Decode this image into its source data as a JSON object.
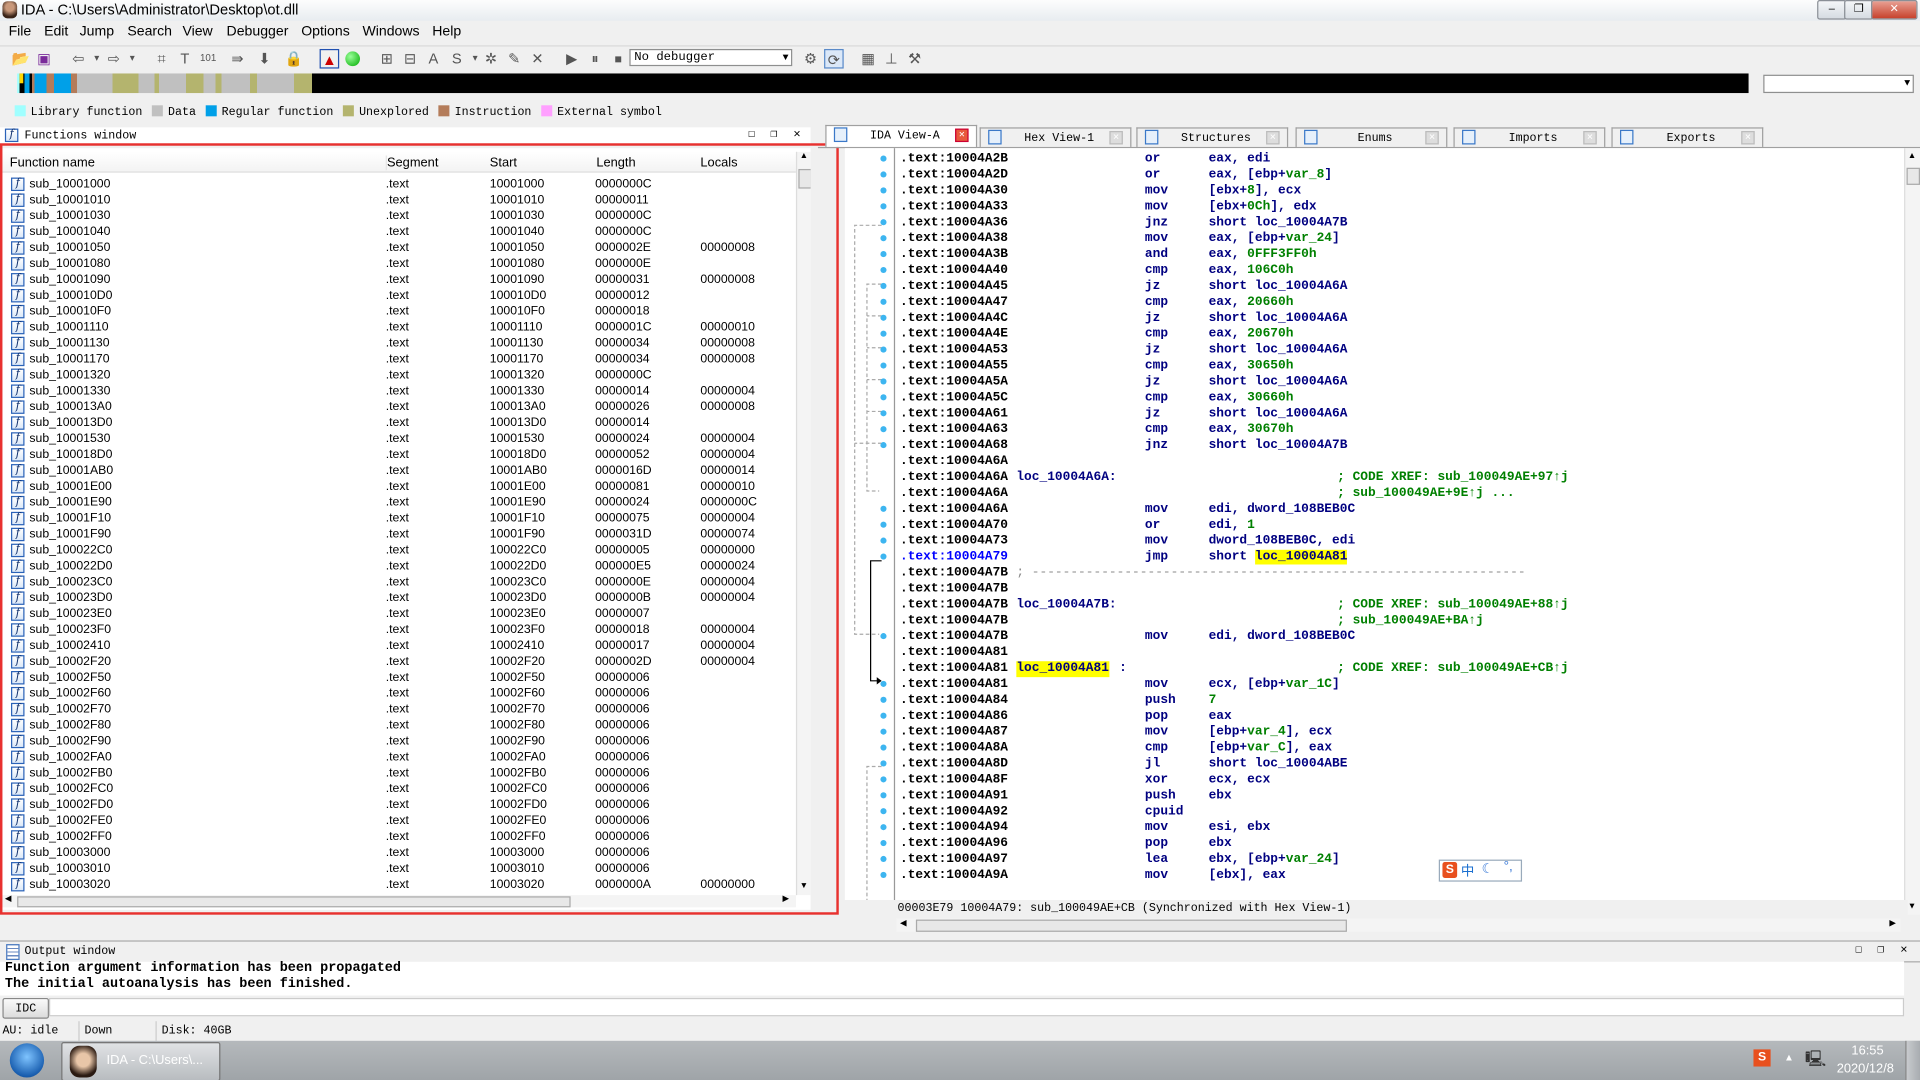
{
  "window": {
    "title": "IDA - C:\\Users\\Administrator\\Desktop\\ot.dll"
  },
  "menu": [
    "File",
    "Edit",
    "Jump",
    "Search",
    "View",
    "Debugger",
    "Options",
    "Windows",
    "Help"
  ],
  "toolbar": {
    "debugger_select": "No debugger"
  },
  "legend": [
    {
      "label": "Library function",
      "color": "#a0ffff"
    },
    {
      "label": "Data",
      "color": "#c0c0c0"
    },
    {
      "label": "Regular function",
      "color": "#00a0e8"
    },
    {
      "label": "Unexplored",
      "color": "#b4b46e"
    },
    {
      "label": "Instruction",
      "color": "#b47c5a"
    },
    {
      "label": "External symbol",
      "color": "#ffa0ff"
    }
  ],
  "functions_window": {
    "title": "Functions window",
    "columns": [
      "Function name",
      "Segment",
      "Start",
      "Length",
      "Locals"
    ],
    "rows": [
      [
        "sub_10001000",
        ".text",
        "10001000",
        "0000000C",
        ""
      ],
      [
        "sub_10001010",
        ".text",
        "10001010",
        "00000011",
        ""
      ],
      [
        "sub_10001030",
        ".text",
        "10001030",
        "0000000C",
        ""
      ],
      [
        "sub_10001040",
        ".text",
        "10001040",
        "0000000C",
        ""
      ],
      [
        "sub_10001050",
        ".text",
        "10001050",
        "0000002E",
        "00000008"
      ],
      [
        "sub_10001080",
        ".text",
        "10001080",
        "0000000E",
        ""
      ],
      [
        "sub_10001090",
        ".text",
        "10001090",
        "00000031",
        "00000008"
      ],
      [
        "sub_100010D0",
        ".text",
        "100010D0",
        "00000012",
        ""
      ],
      [
        "sub_100010F0",
        ".text",
        "100010F0",
        "00000018",
        ""
      ],
      [
        "sub_10001110",
        ".text",
        "10001110",
        "0000001C",
        "00000010"
      ],
      [
        "sub_10001130",
        ".text",
        "10001130",
        "00000034",
        "00000008"
      ],
      [
        "sub_10001170",
        ".text",
        "10001170",
        "00000034",
        "00000008"
      ],
      [
        "sub_10001320",
        ".text",
        "10001320",
        "0000000C",
        ""
      ],
      [
        "sub_10001330",
        ".text",
        "10001330",
        "00000014",
        "00000004"
      ],
      [
        "sub_100013A0",
        ".text",
        "100013A0",
        "00000026",
        "00000008"
      ],
      [
        "sub_100013D0",
        ".text",
        "100013D0",
        "00000014",
        ""
      ],
      [
        "sub_10001530",
        ".text",
        "10001530",
        "00000024",
        "00000004"
      ],
      [
        "sub_100018D0",
        ".text",
        "100018D0",
        "00000052",
        "00000004"
      ],
      [
        "sub_10001AB0",
        ".text",
        "10001AB0",
        "0000016D",
        "00000014"
      ],
      [
        "sub_10001E00",
        ".text",
        "10001E00",
        "00000081",
        "00000010"
      ],
      [
        "sub_10001E90",
        ".text",
        "10001E90",
        "00000024",
        "0000000C"
      ],
      [
        "sub_10001F10",
        ".text",
        "10001F10",
        "00000075",
        "00000004"
      ],
      [
        "sub_10001F90",
        ".text",
        "10001F90",
        "0000031D",
        "00000074"
      ],
      [
        "sub_100022C0",
        ".text",
        "100022C0",
        "00000005",
        "00000000"
      ],
      [
        "sub_100022D0",
        ".text",
        "100022D0",
        "000000E5",
        "00000024"
      ],
      [
        "sub_100023C0",
        ".text",
        "100023C0",
        "0000000E",
        "00000004"
      ],
      [
        "sub_100023D0",
        ".text",
        "100023D0",
        "0000000B",
        "00000004"
      ],
      [
        "sub_100023E0",
        ".text",
        "100023E0",
        "00000007",
        ""
      ],
      [
        "sub_100023F0",
        ".text",
        "100023F0",
        "00000018",
        "00000004"
      ],
      [
        "sub_10002410",
        ".text",
        "10002410",
        "00000017",
        "00000004"
      ],
      [
        "sub_10002F20",
        ".text",
        "10002F20",
        "0000002D",
        "00000004"
      ],
      [
        "sub_10002F50",
        ".text",
        "10002F50",
        "00000006",
        ""
      ],
      [
        "sub_10002F60",
        ".text",
        "10002F60",
        "00000006",
        ""
      ],
      [
        "sub_10002F70",
        ".text",
        "10002F70",
        "00000006",
        ""
      ],
      [
        "sub_10002F80",
        ".text",
        "10002F80",
        "00000006",
        ""
      ],
      [
        "sub_10002F90",
        ".text",
        "10002F90",
        "00000006",
        ""
      ],
      [
        "sub_10002FA0",
        ".text",
        "10002FA0",
        "00000006",
        ""
      ],
      [
        "sub_10002FB0",
        ".text",
        "10002FB0",
        "00000006",
        ""
      ],
      [
        "sub_10002FC0",
        ".text",
        "10002FC0",
        "00000006",
        ""
      ],
      [
        "sub_10002FD0",
        ".text",
        "10002FD0",
        "00000006",
        ""
      ],
      [
        "sub_10002FE0",
        ".text",
        "10002FE0",
        "00000006",
        ""
      ],
      [
        "sub_10002FF0",
        ".text",
        "10002FF0",
        "00000006",
        ""
      ],
      [
        "sub_10003000",
        ".text",
        "10003000",
        "00000006",
        ""
      ],
      [
        "sub_10003010",
        ".text",
        "10003010",
        "00000006",
        ""
      ],
      [
        "sub_10003020",
        ".text",
        "10003020",
        "0000000A",
        "00000000"
      ]
    ]
  },
  "tabs": [
    {
      "label": "IDA View-A",
      "active": true
    },
    {
      "label": "Hex View-1"
    },
    {
      "label": "Structures"
    },
    {
      "label": "Enums"
    },
    {
      "label": "Imports"
    },
    {
      "label": "Exports"
    }
  ],
  "disasm": {
    "lines": [
      {
        "addr": ".text:10004A2B",
        "mn": "or",
        "op": "eax, edi"
      },
      {
        "addr": ".text:10004A2D",
        "mn": "or",
        "op": "eax, [ebp+var_8]"
      },
      {
        "addr": ".text:10004A30",
        "mn": "mov",
        "op": "[ebx+8], ecx"
      },
      {
        "addr": ".text:10004A33",
        "mn": "mov",
        "op": "[ebx+0Ch], edx"
      },
      {
        "addr": ".text:10004A36",
        "mn": "jnz",
        "op": "short loc_10004A7B"
      },
      {
        "addr": ".text:10004A38",
        "mn": "mov",
        "op": "eax, [ebp+var_24]"
      },
      {
        "addr": ".text:10004A3B",
        "mn": "and",
        "op": "eax, 0FFF3FF0h"
      },
      {
        "addr": ".text:10004A40",
        "mn": "cmp",
        "op": "eax, 106C0h"
      },
      {
        "addr": ".text:10004A45",
        "mn": "jz",
        "op": "short loc_10004A6A"
      },
      {
        "addr": ".text:10004A47",
        "mn": "cmp",
        "op": "eax, 20660h"
      },
      {
        "addr": ".text:10004A4C",
        "mn": "jz",
        "op": "short loc_10004A6A"
      },
      {
        "addr": ".text:10004A4E",
        "mn": "cmp",
        "op": "eax, 20670h"
      },
      {
        "addr": ".text:10004A53",
        "mn": "jz",
        "op": "short loc_10004A6A"
      },
      {
        "addr": ".text:10004A55",
        "mn": "cmp",
        "op": "eax, 30650h"
      },
      {
        "addr": ".text:10004A5A",
        "mn": "jz",
        "op": "short loc_10004A6A"
      },
      {
        "addr": ".text:10004A5C",
        "mn": "cmp",
        "op": "eax, 30660h"
      },
      {
        "addr": ".text:10004A61",
        "mn": "jz",
        "op": "short loc_10004A6A"
      },
      {
        "addr": ".text:10004A63",
        "mn": "cmp",
        "op": "eax, 30670h"
      },
      {
        "addr": ".text:10004A68",
        "mn": "jnz",
        "op": "short loc_10004A7B"
      },
      {
        "addr": ".text:10004A6A"
      },
      {
        "addr": ".text:10004A6A",
        "label": "loc_10004A6A:",
        "comment": "; CODE XREF: sub_100049AE+97↑j"
      },
      {
        "addr": ".text:10004A6A",
        "comment": "; sub_100049AE+9E↑j ..."
      },
      {
        "addr": ".text:10004A6A",
        "mn": "mov",
        "op": "edi, dword_108BEB0C"
      },
      {
        "addr": ".text:10004A70",
        "mn": "or",
        "op": "edi, 1"
      },
      {
        "addr": ".text:10004A73",
        "mn": "mov",
        "op": "dword_108BEB0C, edi"
      },
      {
        "addr": ".text:10004A79",
        "mn": "jmp",
        "op": "short ",
        "op_hl": "loc_10004A81",
        "current": true
      },
      {
        "addr": ".text:10004A7B",
        "separator": "; ----------------------------------------------------------------"
      },
      {
        "addr": ".text:10004A7B"
      },
      {
        "addr": ".text:10004A7B",
        "label": "loc_10004A7B:",
        "comment": "; CODE XREF: sub_100049AE+88↑j"
      },
      {
        "addr": ".text:10004A7B",
        "comment": "; sub_100049AE+BA↑j"
      },
      {
        "addr": ".text:10004A7B",
        "mn": "mov",
        "op": "edi, dword_108BEB0C"
      },
      {
        "addr": ".text:10004A81"
      },
      {
        "addr": ".text:10004A81",
        "label": "loc_10004A81",
        "label_suffix": ":",
        "label_hl": true,
        "comment": "; CODE XREF: sub_100049AE+CB↑j"
      },
      {
        "addr": ".text:10004A81",
        "mn": "mov",
        "op": "ecx, [ebp+var_1C]"
      },
      {
        "addr": ".text:10004A84",
        "mn": "push",
        "op": "7"
      },
      {
        "addr": ".text:10004A86",
        "mn": "pop",
        "op": "eax"
      },
      {
        "addr": ".text:10004A87",
        "mn": "mov",
        "op": "[ebp+var_4], ecx"
      },
      {
        "addr": ".text:10004A8A",
        "mn": "cmp",
        "op": "[ebp+var_C], eax"
      },
      {
        "addr": ".text:10004A8D",
        "mn": "jl",
        "op": "short loc_10004ABE"
      },
      {
        "addr": ".text:10004A8F",
        "mn": "xor",
        "op": "ecx, ecx"
      },
      {
        "addr": ".text:10004A91",
        "mn": "push",
        "op": "ebx"
      },
      {
        "addr": ".text:10004A92",
        "mn": "cpuid"
      },
      {
        "addr": ".text:10004A94",
        "mn": "mov",
        "op": "esi, ebx"
      },
      {
        "addr": ".text:10004A96",
        "mn": "pop",
        "op": "ebx"
      },
      {
        "addr": ".text:10004A97",
        "mn": "lea",
        "op": "ebx, [ebp+var_24]"
      },
      {
        "addr": ".text:10004A9A",
        "mn": "mov",
        "op": "[ebx], eax"
      }
    ],
    "status": "00003E79 10004A79: sub_100049AE+CB (Synchronized with Hex View-1)"
  },
  "ime": {
    "label": "中"
  },
  "output_window": {
    "title": "Output window",
    "lines": [
      "Function argument information has been propagated",
      "The initial autoanalysis has been finished."
    ],
    "idc_button": "IDC",
    "input_value": ""
  },
  "statusbar": {
    "au": "AU:  idle",
    "direction": "Down",
    "disk": "Disk: 40GB"
  },
  "taskbar": {
    "app_label": "IDA - C:\\Users\\...",
    "time": "16:55",
    "date": "2020/12/8"
  },
  "colors": {
    "highlight": "#ffff00",
    "selection_border": "#e8312f",
    "mnemonic": "#000080",
    "number": "#008000"
  }
}
